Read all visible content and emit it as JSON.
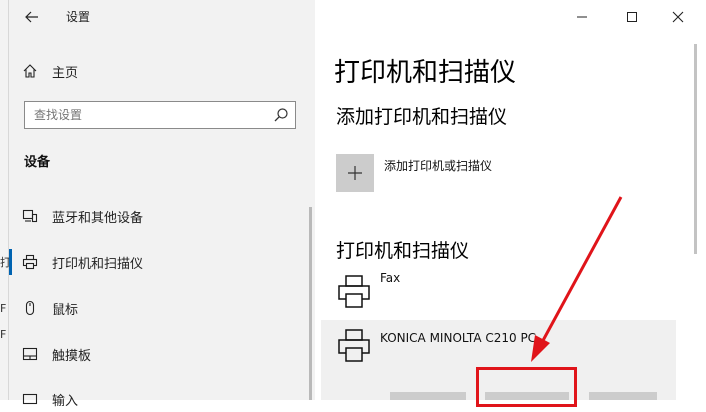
{
  "window": {
    "title": "设置",
    "controls": {
      "minimize": "—",
      "maximize": "☐",
      "close": "✕"
    }
  },
  "left_strip": {
    "fragments": [
      "打",
      "F",
      "F"
    ]
  },
  "sidebar": {
    "home_label": "主页",
    "search_placeholder": "查找设置",
    "section_heading": "设备",
    "items": [
      {
        "label": "蓝牙和其他设备",
        "icon": "bluetooth-devices-icon"
      },
      {
        "label": "打印机和扫描仪",
        "icon": "printer-icon",
        "selected": true
      },
      {
        "label": "鼠标",
        "icon": "mouse-icon"
      },
      {
        "label": "触摸板",
        "icon": "touchpad-icon"
      },
      {
        "label": "输入",
        "icon": "keyboard-icon"
      }
    ]
  },
  "main": {
    "page_title": "打印机和扫描仪",
    "add_section_title": "添加打印机和扫描仪",
    "add_button_label": "添加打印机或扫描仪",
    "list_section_title": "打印机和扫描仪",
    "printers": [
      {
        "name": "Fax",
        "icon": "printer-icon"
      },
      {
        "name": "KONICA MINOLTA C210 PC",
        "icon": "printer-icon",
        "selected": true
      }
    ]
  },
  "annotation": {
    "color": "#e0141a"
  },
  "colors": {
    "accent": "#0063b1",
    "pane_bg": "#f2f2f2"
  }
}
